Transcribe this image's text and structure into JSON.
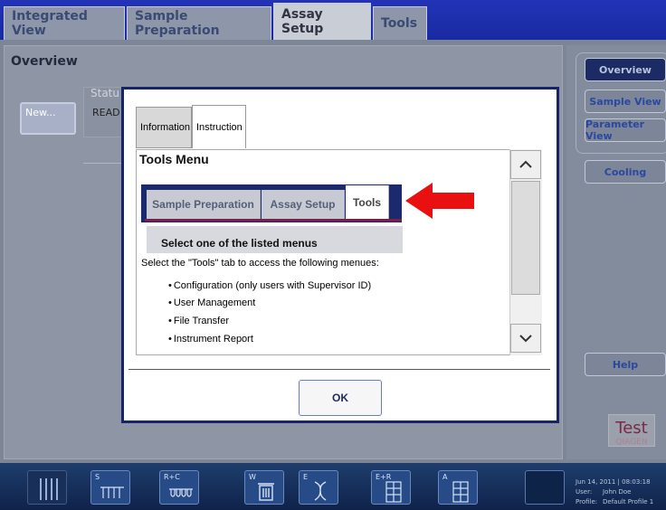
{
  "top_tabs": [
    {
      "label": "Integrated View"
    },
    {
      "label": "Sample Preparation"
    },
    {
      "label": "Assay Setup"
    },
    {
      "label": "Tools"
    }
  ],
  "background": {
    "overview_title": "Overview",
    "status_header": "Statu",
    "status_value": "READ",
    "new_button": "New..."
  },
  "right_panel": {
    "buttons": [
      {
        "label": "Overview"
      },
      {
        "label": "Sample View"
      },
      {
        "label": "Parameter View"
      },
      {
        "label": "Cooling"
      },
      {
        "label": "Help"
      }
    ],
    "logo_text": "Test",
    "brand_text": "QIAGEN"
  },
  "bottom_bar": {
    "slots": [
      {
        "label": ""
      },
      {
        "label": "S"
      },
      {
        "label": "R+C"
      },
      {
        "label": "W"
      },
      {
        "label": "E"
      },
      {
        "label": "E+R"
      },
      {
        "label": "A"
      },
      {
        "label": ""
      }
    ],
    "datetime": "Jun 14, 2011 | 08:03:18",
    "user_label": "User:",
    "user_value": "John Doe",
    "profile_label": "Profile:",
    "profile_value": "Default Profile 1"
  },
  "dialog": {
    "tabs": [
      {
        "label": "Information"
      },
      {
        "label": "Instruction"
      }
    ],
    "title": "Tools Menu",
    "picture_tabs": [
      {
        "label": "Sample Preparation"
      },
      {
        "label": "Assay Setup"
      },
      {
        "label": "Tools"
      }
    ],
    "picture_caption": "Select one of the listed menus",
    "instruction": "Select the \"Tools\" tab to access the following menues:",
    "bullets": [
      "Configuration (only users with Supervisor ID)",
      "User Management",
      "File Transfer",
      "Instrument Report"
    ],
    "ok_button": "OK"
  },
  "colors": {
    "arrow": "#e81010",
    "dialog_border": "#16246a",
    "accent": "#2a48a0"
  }
}
